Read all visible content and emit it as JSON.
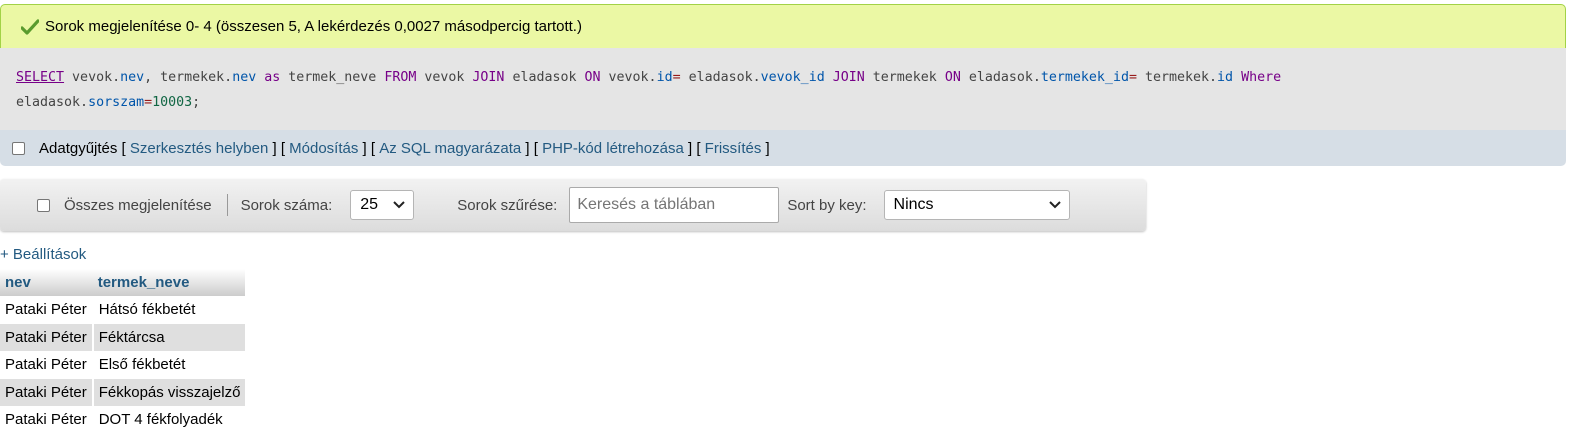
{
  "message": {
    "text": "Sorok megjelenítése 0- 4 (összesen 5, A lekérdezés 0,0027 másodpercig tartott.)",
    "icon": "success-check-icon"
  },
  "sql": {
    "tokens": [
      {
        "t": "SELECT",
        "c": "kw u"
      },
      {
        "t": " vevok."
      },
      {
        "t": "nev",
        "c": "pr"
      },
      {
        "t": ", termekek."
      },
      {
        "t": "nev",
        "c": "pr"
      },
      {
        "t": " "
      },
      {
        "t": "as",
        "c": "kw"
      },
      {
        "t": " termek_neve "
      },
      {
        "t": "FROM",
        "c": "kw"
      },
      {
        "t": " vevok "
      },
      {
        "t": "JOIN",
        "c": "kw"
      },
      {
        "t": " eladasok "
      },
      {
        "t": "ON",
        "c": "kw"
      },
      {
        "t": " vevok."
      },
      {
        "t": "id",
        "c": "pr"
      },
      {
        "t": "=",
        "c": "op"
      },
      {
        "t": " eladasok."
      },
      {
        "t": "vevok_id",
        "c": "pr"
      },
      {
        "t": " "
      },
      {
        "t": "JOIN",
        "c": "kw"
      },
      {
        "t": " termekek "
      },
      {
        "t": "ON",
        "c": "kw"
      },
      {
        "t": " eladasok."
      },
      {
        "t": "termekek_id",
        "c": "pr"
      },
      {
        "t": "=",
        "c": "op"
      },
      {
        "t": " termekek."
      },
      {
        "t": "id",
        "c": "pr"
      },
      {
        "t": " "
      },
      {
        "t": "Where",
        "c": "kw"
      },
      {
        "t": "\n"
      },
      {
        "t": "eladasok."
      },
      {
        "t": "sorszam",
        "c": "pr"
      },
      {
        "t": "=",
        "c": "op"
      },
      {
        "t": "10003",
        "c": "nm"
      },
      {
        "t": ";"
      }
    ]
  },
  "actions": {
    "profiling_label": "Adatgyűjtés",
    "links": [
      "Szerkesztés helyben",
      "Módosítás",
      "Az SQL magyarázata",
      "PHP-kód létrehozása",
      "Frissítés"
    ]
  },
  "navbar": {
    "show_all_label": "Összes megjelenítése",
    "rows_label": "Sorok száma:",
    "rows_value": "25",
    "filter_label": "Sorok szűrése:",
    "filter_placeholder": "Keresés a táblában",
    "sort_label": "Sort by key:",
    "sort_value": "Nincs"
  },
  "settings_link": "+ Beállítások",
  "table": {
    "headers": [
      "nev",
      "termek_neve"
    ],
    "rows": [
      [
        "Pataki Péter",
        "Hátsó fékbetét"
      ],
      [
        "Pataki Péter",
        "Féktárcsa"
      ],
      [
        "Pataki Péter",
        "Első fékbetét"
      ],
      [
        "Pataki Péter",
        "Fékkopás visszajelző"
      ],
      [
        "Pataki Péter",
        "DOT 4 fékfolyadék"
      ]
    ]
  }
}
